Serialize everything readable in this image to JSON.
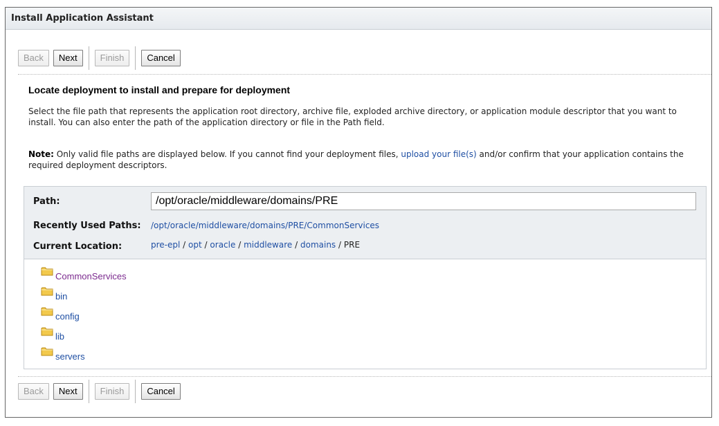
{
  "window": {
    "title": "Install Application Assistant"
  },
  "buttons": {
    "back": "Back",
    "next": "Next",
    "finish": "Finish",
    "cancel": "Cancel"
  },
  "content": {
    "heading": "Locate deployment to install and prepare for deployment",
    "description": "Select the file path that represents the application root directory, archive file, exploded archive directory, or application module descriptor that you want to install. You can also enter the path of the application directory or file in the Path field.",
    "note_label": "Note:",
    "note_before": " Only valid file paths are displayed below. If you cannot find your deployment files, ",
    "note_link": "upload your file(s)",
    "note_after": " and/or confirm that your application contains the required deployment descriptors."
  },
  "path": {
    "label": "Path:",
    "value": "/opt/oracle/middleware/domains/PRE",
    "recent_label": "Recently Used Paths:",
    "recent_value": "/opt/oracle/middleware/domains/PRE/CommonServices",
    "location_label": "Current Location:",
    "crumbs": [
      "pre-epl",
      "opt",
      "oracle",
      "middleware",
      "domains",
      "PRE"
    ],
    "sep": "/"
  },
  "folders": [
    "CommonServices",
    "bin",
    "config",
    "lib",
    "servers"
  ],
  "colors": {
    "link": "#1f4fa3",
    "visited": "#7b2a8e",
    "folder": "#f2c94c"
  },
  "icons": {
    "folder": "folder-icon"
  }
}
